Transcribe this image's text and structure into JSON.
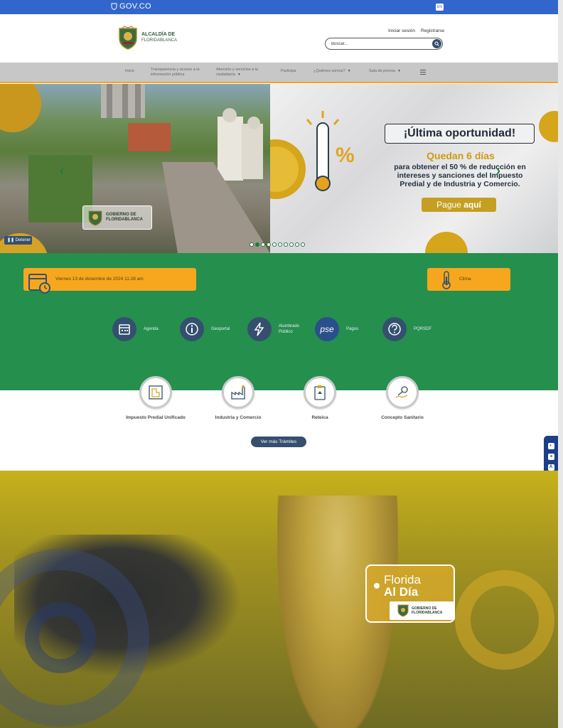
{
  "govbar": {
    "logo_text": "GOV.CO",
    "lang_label": "EN"
  },
  "header": {
    "logo_line1": "ALCALDÍA DE",
    "logo_line2": "FLORIDABLANCA",
    "login": "Iniciar sesión",
    "register": "Registrarse",
    "search_placeholder": "Buscar..."
  },
  "nav": {
    "items": [
      {
        "label": "Inicio"
      },
      {
        "label": "Transparencia y acceso a la información pública"
      },
      {
        "label": "Atención y servicios a la ciudadanía"
      },
      {
        "label": "Participa"
      },
      {
        "label": "¿Quiénes somos?"
      },
      {
        "label": "Sala de prensa"
      }
    ]
  },
  "carousel": {
    "promo_title": "¡Última oportunidad!",
    "promo_subtitle": "Quedan 6 días",
    "promo_body": "para obtener el 50 % de reducción en intereses y sanciones del Impuesto Predial y de Industria y Comercio.",
    "promo_cta_prefix": "Pague",
    "promo_cta_bold": "aquí",
    "badge_line1": "GOBIERNO DE",
    "badge_line2": "FLORIDABLANCA",
    "stop_label": "Detener",
    "slide_count": 10,
    "active_slide": 1
  },
  "info": {
    "date_text": "Viernes 13 de diciembre de 2024 11:28 am",
    "clima_label": "Clima"
  },
  "quick_links": [
    {
      "label": "Agenda",
      "icon": "calendar-icon"
    },
    {
      "label": "Geoportal",
      "icon": "info-icon"
    },
    {
      "label": "Alumbrado Público",
      "icon": "lightning-icon"
    },
    {
      "label": "Pagos",
      "icon": "pse-icon"
    },
    {
      "label": "PQRSDF",
      "icon": "question-icon"
    }
  ],
  "pse_text": "pse",
  "tramites": [
    {
      "label": "Impuesto Predial Unificado",
      "icon": "blueprint-icon"
    },
    {
      "label": "Industria y Comercio",
      "icon": "factory-icon"
    },
    {
      "label": "Reteica",
      "icon": "clipboard-icon"
    },
    {
      "label": "Concepto Sanitario",
      "icon": "key-hand-icon"
    }
  ],
  "ver_mas": "Ver más Trámites",
  "banner": {
    "florida_line1": "Florida",
    "florida_line2": "Al Día",
    "gob_line1": "GOBIERNO DE",
    "gob_line2": "FLORIDABLANCA"
  },
  "colors": {
    "gov_blue": "#3366cc",
    "green": "#258f4e",
    "orange": "#f6a71e",
    "navy": "#34506e",
    "gold": "#c59f22"
  }
}
